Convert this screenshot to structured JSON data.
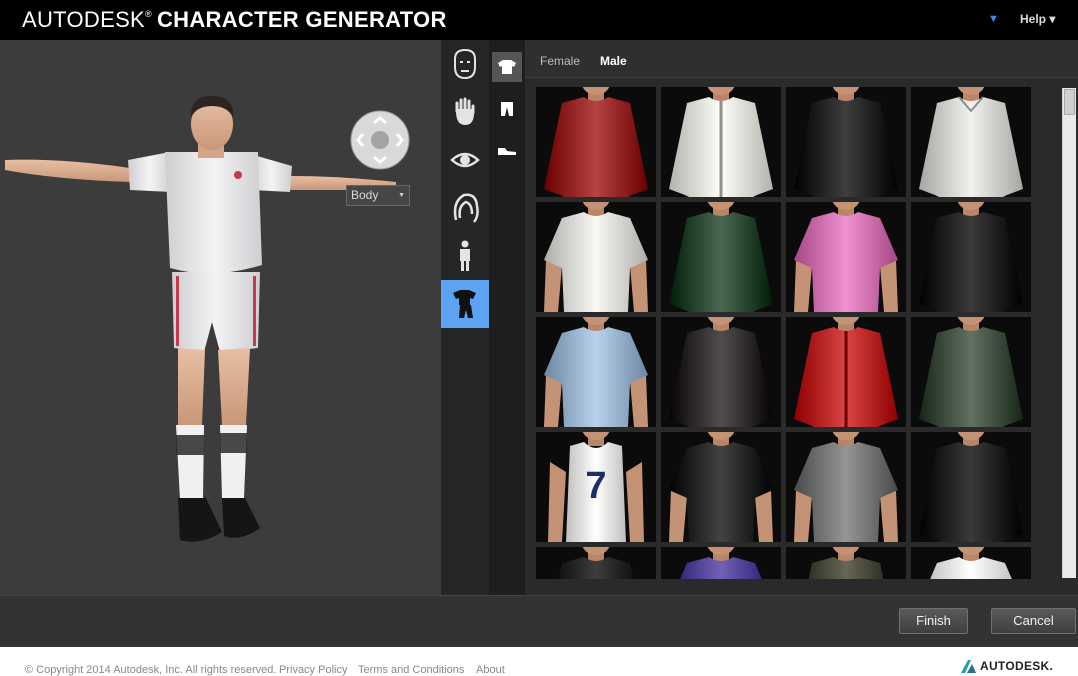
{
  "app": {
    "brand_light": "AUTODESK",
    "brand_reg": "®",
    "brand_bold": "CHARACTER GENERATOR",
    "help_label": "Help ▾",
    "lang_arrow": "▼"
  },
  "viewport": {
    "part_select_value": "Body"
  },
  "categories": [
    {
      "name": "face",
      "icon": "face-icon",
      "selected": false
    },
    {
      "name": "skin",
      "icon": "hand-icon",
      "selected": false
    },
    {
      "name": "eyes",
      "icon": "eye-icon",
      "selected": false
    },
    {
      "name": "hair",
      "icon": "hair-icon",
      "selected": false
    },
    {
      "name": "body",
      "icon": "body-icon",
      "selected": false
    },
    {
      "name": "clothing",
      "icon": "clothing-icon",
      "selected": true
    }
  ],
  "subcategories": [
    {
      "name": "tops",
      "icon": "shirt-icon",
      "selected": true
    },
    {
      "name": "bottoms",
      "icon": "pants-icon",
      "selected": false
    },
    {
      "name": "shoes",
      "icon": "shoe-icon",
      "selected": false
    }
  ],
  "gallery": {
    "tabs": [
      "Female",
      "Male"
    ],
    "active_tab": "Male",
    "items": [
      {
        "label": "red knit sweater",
        "color": "#8e1a1a",
        "style": "long"
      },
      {
        "label": "white zip jacket",
        "color": "#d6d6d0",
        "style": "jacket"
      },
      {
        "label": "black sweater",
        "color": "#161616",
        "style": "long"
      },
      {
        "label": "white button shirt",
        "color": "#c9c9c5",
        "style": "shirt"
      },
      {
        "label": "white short sleeve shirt",
        "color": "#d0d0cc",
        "style": "short"
      },
      {
        "label": "green knit sweater",
        "color": "#22402a",
        "style": "long"
      },
      {
        "label": "pink floral shirt",
        "color": "#c86aa8",
        "style": "short"
      },
      {
        "label": "black top",
        "color": "#121212",
        "style": "long"
      },
      {
        "label": "denim shirt",
        "color": "#90aac6",
        "style": "short"
      },
      {
        "label": "dark hoodie",
        "color": "#2a2626",
        "style": "long"
      },
      {
        "label": "red track jacket",
        "color": "#b21c1c",
        "style": "jacket"
      },
      {
        "label": "dark green sweater",
        "color": "#3a4a3a",
        "style": "long"
      },
      {
        "label": "number 7 tank top",
        "color": "#e2e2e0",
        "style": "tank",
        "text": "7"
      },
      {
        "label": "graphic black tee",
        "color": "#1b1b1b",
        "style": "short"
      },
      {
        "label": "grey tee",
        "color": "#6d6d6d",
        "style": "short"
      },
      {
        "label": "black leather jacket",
        "color": "#111111",
        "style": "long"
      },
      {
        "label": "black biker jacket",
        "color": "#151515",
        "style": "long"
      },
      {
        "label": "purple shirt",
        "color": "#4a3a8e",
        "style": "short"
      },
      {
        "label": "camo jacket",
        "color": "#3f3f30",
        "style": "long"
      },
      {
        "label": "white tee",
        "color": "#d8d8d8",
        "style": "short"
      }
    ]
  },
  "actions": {
    "finish_label": "Finish",
    "cancel_label": "Cancel"
  },
  "footer": {
    "copyright": "© Copyright 2014 Autodesk, Inc. All rights reserved.",
    "privacy": "Privacy Policy",
    "terms": "Terms and Conditions",
    "about": "About",
    "logo_text": "AUTODESK."
  }
}
